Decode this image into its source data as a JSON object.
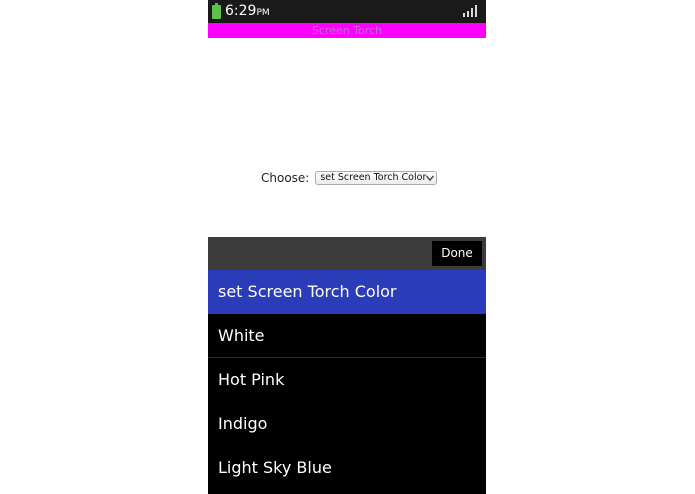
{
  "status_bar": {
    "time": "6:29",
    "ampm": "PM",
    "battery_color": "#5cc24c"
  },
  "app": {
    "title": "Screen Torch",
    "title_bar_color": "#ff00ff"
  },
  "form": {
    "choose_label": "Choose:",
    "selected_value": "set Screen Torch Color"
  },
  "picker": {
    "done_label": "Done",
    "selected_color": "#2b3cb8",
    "options": [
      {
        "label": "set Screen Torch Color"
      },
      {
        "label": "White"
      },
      {
        "label": "Hot Pink"
      },
      {
        "label": "Indigo"
      },
      {
        "label": "Light Sky Blue"
      }
    ]
  }
}
